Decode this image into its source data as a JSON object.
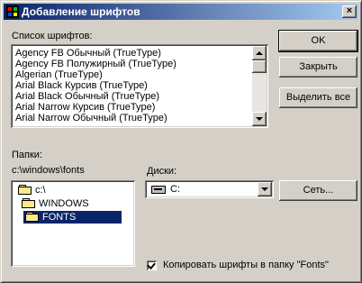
{
  "window": {
    "title": "Добавление шрифтов",
    "close_glyph": "×"
  },
  "fonts_list": {
    "label": "Список шрифтов:",
    "items": [
      "Agency FB Обычный (TrueType)",
      "Agency FB Полужирный (TrueType)",
      "Algerian (TrueType)",
      "Arial Black Курсив (TrueType)",
      "Arial Black Обычный (TrueType)",
      "Arial Narrow Курсив (TrueType)",
      "Arial Narrow Обычный (TrueType)"
    ]
  },
  "buttons": {
    "ok": "OK",
    "close": "Закрыть",
    "select_all": "Выделить все",
    "network": "Сеть..."
  },
  "folders": {
    "label": "Папки:",
    "current_path": "c:\\windows\\fonts",
    "tree": [
      "c:\\",
      "WINDOWS",
      "FONTS"
    ],
    "selected": "FONTS"
  },
  "drives": {
    "label": "Диски:",
    "selected": "C:"
  },
  "copy_option": {
    "label": "Копировать шрифты в папку \"Fonts\"",
    "checked": true
  },
  "colors": {
    "titlebar_start": "#0a246a",
    "titlebar_end": "#a6caf0",
    "selection": "#0a246a",
    "face": "#d4d0c8"
  }
}
